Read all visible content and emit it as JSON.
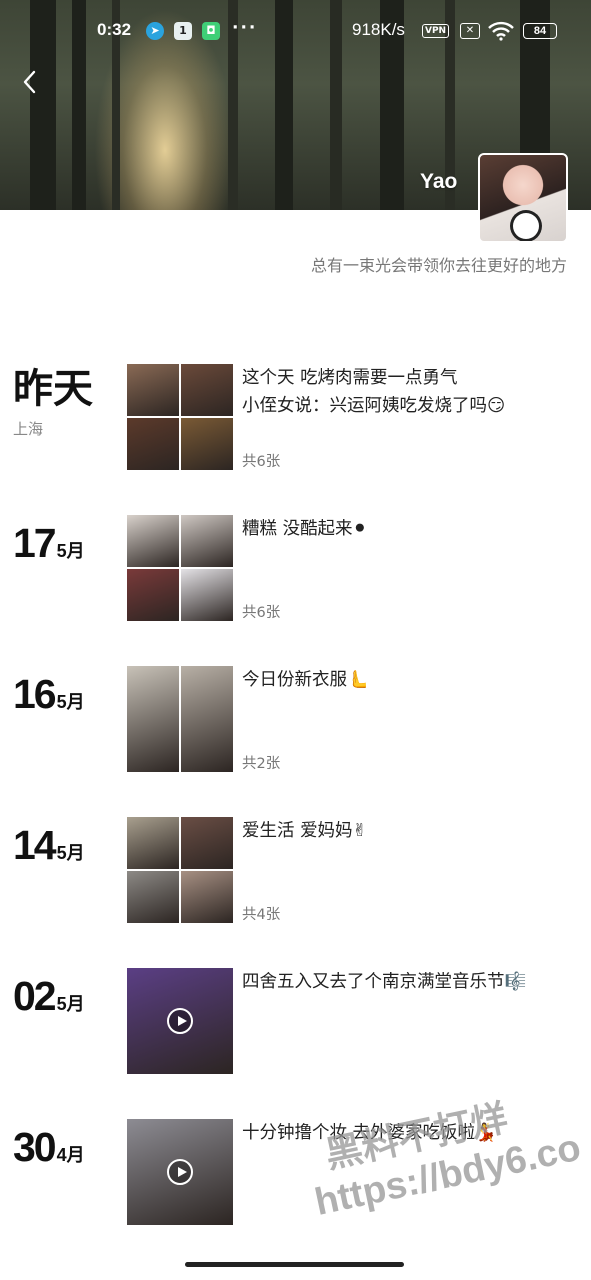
{
  "status_bar": {
    "time": "0:32",
    "app_icon_1": "1",
    "dots": "···",
    "speed": "918K/s",
    "vpn": "VPN",
    "battery": "84"
  },
  "profile": {
    "name": "Yao",
    "signature": "总有一束光会带领你去往更好的地方"
  },
  "posts": [
    {
      "day": "昨天",
      "month": "",
      "location": "上海",
      "lines": [
        "这个天 吃烤肉需要一点勇气",
        "小侄女说：兴运阿姨吃发烧了吗😏"
      ],
      "count": "共6张",
      "photos": 4,
      "video": false,
      "colors": [
        "#8a6a55",
        "#6b4a3a",
        "#5c3a2b",
        "#7a5a35"
      ]
    },
    {
      "day": "17",
      "month": "5月",
      "location": "",
      "lines": [
        "糟糕 没酷起来⚫"
      ],
      "count": "共6张",
      "photos": 4,
      "video": false,
      "colors": [
        "#d9d2cc",
        "#cfc8c3",
        "#7a3a3a",
        "#e4e2e6"
      ]
    },
    {
      "day": "16",
      "month": "5月",
      "location": "",
      "lines": [
        "今日份新衣服🫷"
      ],
      "count": "共2张",
      "photos": 2,
      "video": false,
      "colors": [
        "#c8c2b8",
        "#b8b0a6"
      ]
    },
    {
      "day": "14",
      "month": "5月",
      "location": "",
      "lines": [
        "爱生活 爱妈妈✌"
      ],
      "count": "共4张",
      "photos": 4,
      "video": false,
      "colors": [
        "#a9a08f",
        "#6a4e45",
        "#8d8a86",
        "#a79083"
      ]
    },
    {
      "day": "02",
      "month": "5月",
      "location": "",
      "lines": [
        "四舍五入又去了个南京满堂音乐节🎼"
      ],
      "count": "",
      "photos": 1,
      "video": true,
      "colors": [
        "#5b3f85"
      ]
    },
    {
      "day": "30",
      "month": "4月",
      "location": "",
      "lines": [
        "十分钟撸个妆 去外婆家吃饭啦💃"
      ],
      "count": "",
      "photos": 1,
      "video": true,
      "colors": [
        "#8d8c93"
      ]
    }
  ],
  "watermark": {
    "line1": "黑料不打烊",
    "line2": "https://bdy6.co"
  }
}
